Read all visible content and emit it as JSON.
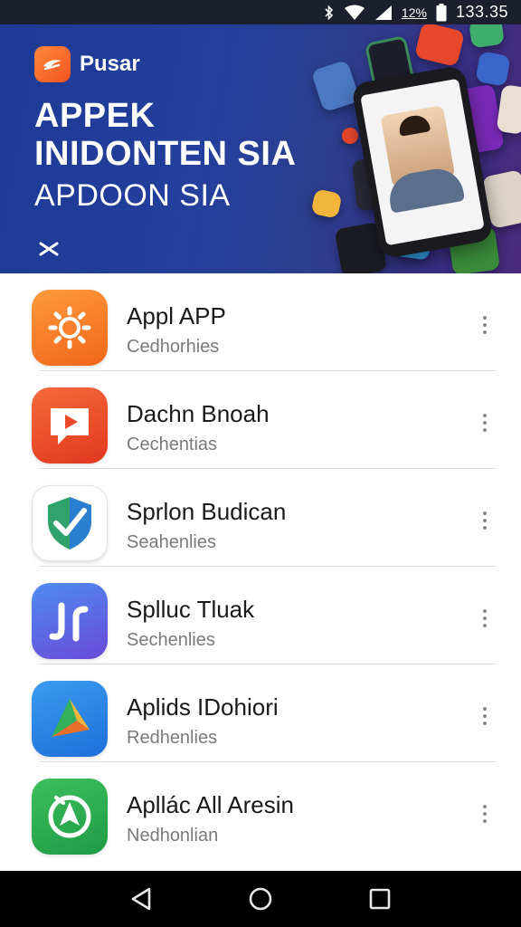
{
  "status_bar": {
    "time": "133.35",
    "battery_text": "12%",
    "icons": [
      "bluetooth-icon",
      "wifi-icon",
      "signal-icon",
      "battery-icon"
    ]
  },
  "banner": {
    "brand_name": "Pusar",
    "headline_line1": "APPEK",
    "headline_line2": "INIDONTEN SIA",
    "headline_line3": "APDOON SIA",
    "colors": {
      "background_start": "#1c3a95",
      "background_end": "#4a2a7a",
      "brand_accent": "#f2531f"
    }
  },
  "apps": [
    {
      "title": "Appl APP",
      "subtitle": "Cedhorhies",
      "icon": "sun-icon",
      "color": "#f57c20"
    },
    {
      "title": "Dachn Bnoah",
      "subtitle": "Cechentias",
      "icon": "play-icon",
      "color": "#ee4a2a"
    },
    {
      "title": "Sprlon Budican",
      "subtitle": "Seahenlies",
      "icon": "shield-check-icon",
      "color": "#ffffff"
    },
    {
      "title": "Splluc Tluak",
      "subtitle": "Sechenlies",
      "icon": "music-note-icon",
      "color": "#5a55e0"
    },
    {
      "title": "Aplids IDohiori",
      "subtitle": "Redhenlies",
      "icon": "triangle-icon",
      "color": "#2a8be8"
    },
    {
      "title": "Apllác All Aresin",
      "subtitle": "Nedhonlian",
      "icon": "navigation-icon",
      "color": "#2fa84a"
    }
  ],
  "nav_bar": {
    "buttons": [
      "back-icon",
      "home-icon",
      "recents-icon"
    ]
  }
}
